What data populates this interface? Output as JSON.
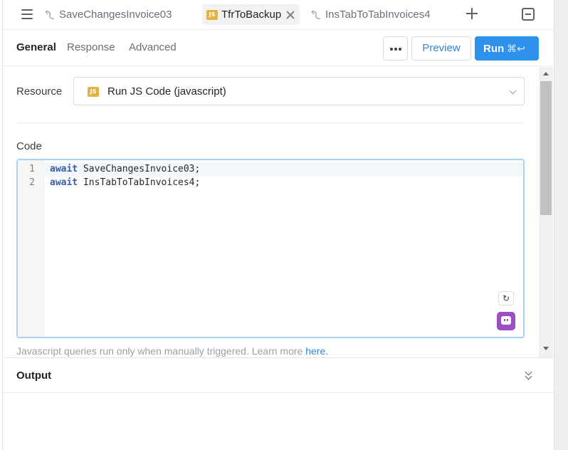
{
  "tabs": [
    {
      "label": "SaveChangesInvoice03",
      "icon": "sql-query-icon",
      "active": false
    },
    {
      "label": "TfrToBackup",
      "icon": "js-icon",
      "active": true
    },
    {
      "label": "InsTabToTabInvoices4",
      "icon": "sql-query-icon",
      "active": false
    }
  ],
  "js_badge": "JS",
  "subtabs": [
    "General",
    "Response",
    "Advanced"
  ],
  "toolbar": {
    "preview_label": "Preview",
    "run_label": "Run",
    "run_shortcut": "⌘↩"
  },
  "resource": {
    "label": "Resource",
    "value": "Run JS Code (javascript)"
  },
  "code": {
    "label": "Code",
    "lines": [
      {
        "n": "1",
        "kw": "await",
        "rest": " SaveChangesInvoice03;"
      },
      {
        "n": "2",
        "kw": "await",
        "rest": " InsTabToTabInvoices4;"
      }
    ]
  },
  "hint": {
    "text": "Javascript queries run only when manually triggered. Learn more ",
    "link": "here."
  },
  "output": {
    "title": "Output"
  },
  "colors": {
    "accent": "#2e92ec",
    "link": "#2f86d8",
    "js_badge": "#e3b341",
    "ai_button": "#9c4fc4"
  }
}
